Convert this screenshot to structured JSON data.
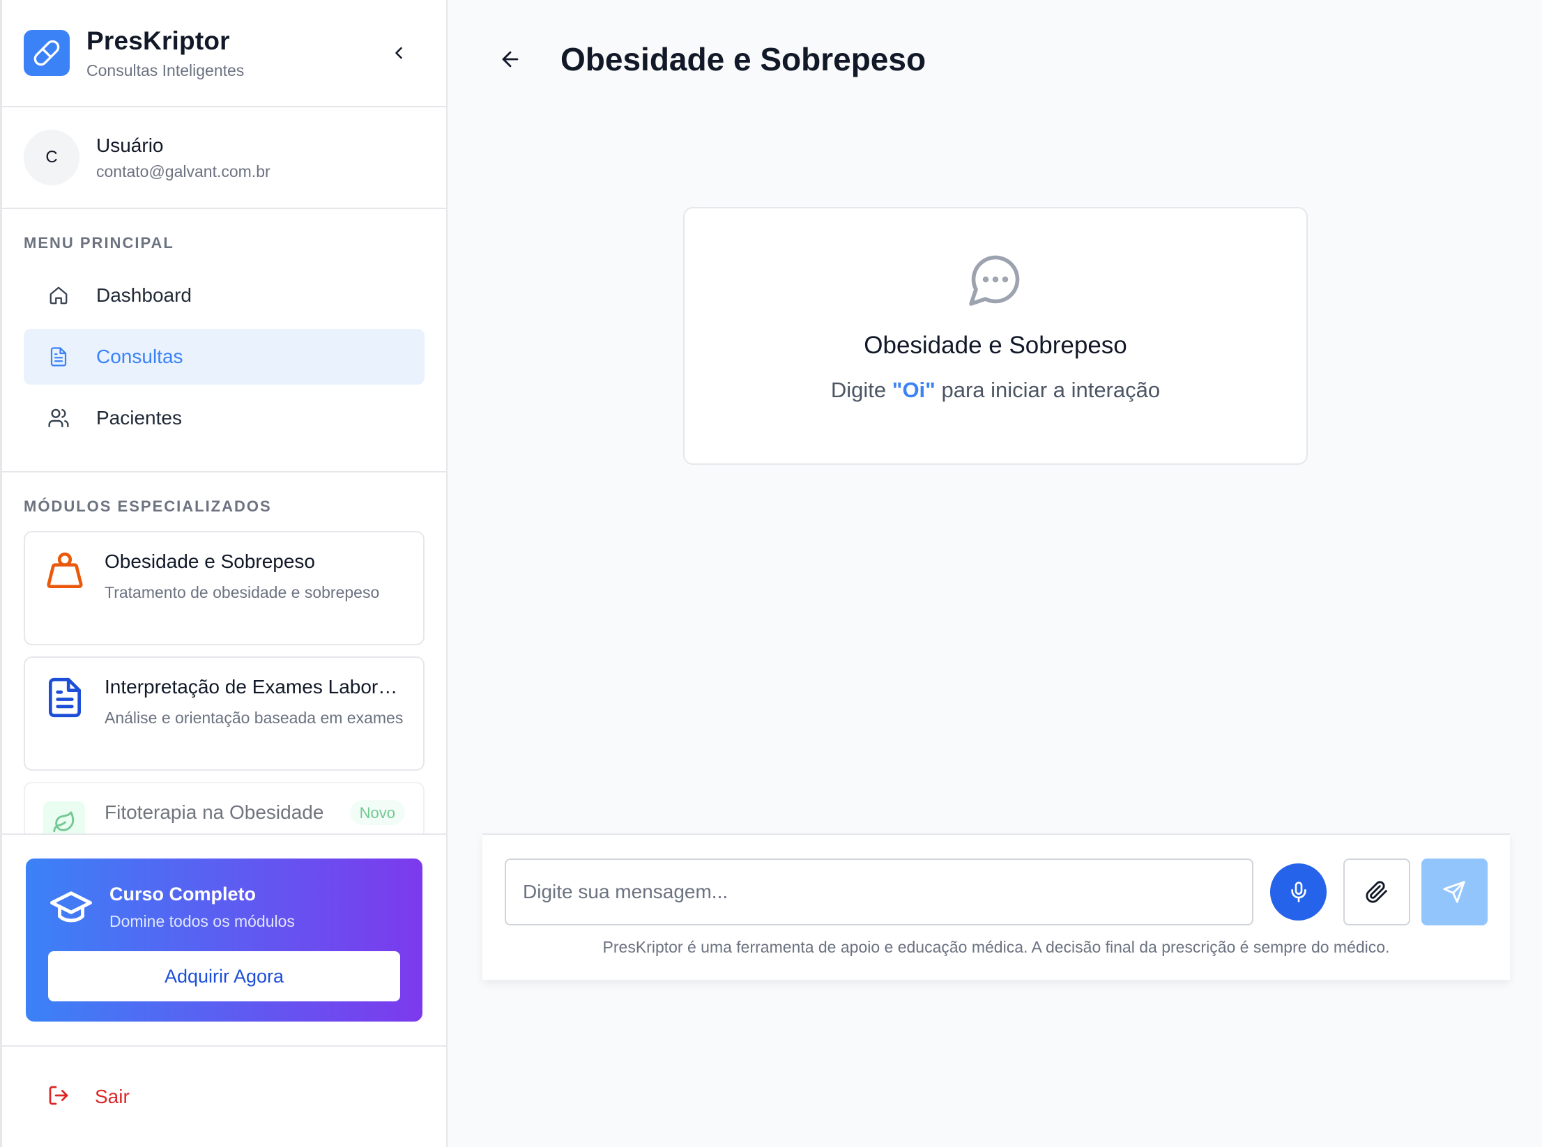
{
  "brand": {
    "name": "PresKriptor",
    "subtitle": "Consultas Inteligentes",
    "accent": "#3b82f6"
  },
  "user": {
    "initial": "C",
    "name": "Usuário",
    "email": "contato@galvant.com.br"
  },
  "menu": {
    "title": "MENU PRINCIPAL",
    "items": [
      {
        "label": "Dashboard",
        "icon": "home-icon",
        "active": false
      },
      {
        "label": "Consultas",
        "icon": "document-icon",
        "active": true
      },
      {
        "label": "Pacientes",
        "icon": "users-icon",
        "active": false
      }
    ]
  },
  "modules": {
    "title": "MÓDULOS ESPECIALIZADOS",
    "items": [
      {
        "title": "Obesidade e Sobrepeso",
        "description": "Tratamento de obesidade e sobrepeso",
        "icon": "weight-icon",
        "icon_color": "#ea580c"
      },
      {
        "title": "Interpretação de Exames Laboratoriais",
        "description": "Análise e orientação baseada em exames",
        "icon": "file-text-icon",
        "icon_color": "#1d4ed8"
      },
      {
        "title": "Fitoterapia na Obesidade",
        "badge": "Novo",
        "icon": "leaf-icon"
      }
    ]
  },
  "promo": {
    "title": "Curso Completo",
    "subtitle": "Domine todos os módulos",
    "button": "Adquirir Agora"
  },
  "logout": {
    "label": "Sair"
  },
  "page": {
    "title": "Obesidade e Sobrepeso"
  },
  "welcome": {
    "title": "Obesidade e Sobrepeso",
    "prefix": "Digite ",
    "highlight": "\"Oi\"",
    "suffix": " para iniciar a interação"
  },
  "composer": {
    "placeholder": "Digite sua mensagem...",
    "disclaimer": "PresKriptor é uma ferramenta de apoio e educação médica. A decisão final da prescrição é sempre do médico."
  }
}
